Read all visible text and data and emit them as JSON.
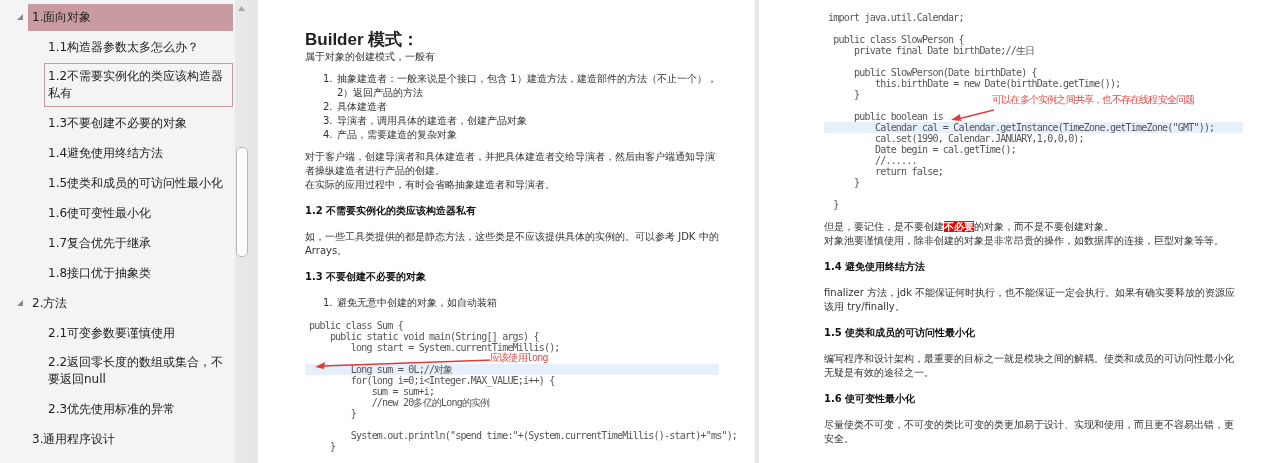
{
  "outline": [
    {
      "label": "1.面向对象",
      "selected": true,
      "focused": false,
      "expanded": true,
      "children": [
        {
          "label": "1.1构造器参数太多怎么办？",
          "selected": false,
          "focused": false
        },
        {
          "label": "1.2不需要实例化的类应该构造器私有",
          "selected": false,
          "focused": true
        },
        {
          "label": "1.3不要创建不必要的对象",
          "selected": false,
          "focused": false
        },
        {
          "label": "1.4避免使用终结方法",
          "selected": false,
          "focused": false
        },
        {
          "label": "1.5使类和成员的可访问性最小化",
          "selected": false,
          "focused": false
        },
        {
          "label": "1.6使可变性最小化",
          "selected": false,
          "focused": false
        },
        {
          "label": "1.7复合优先于继承",
          "selected": false,
          "focused": false
        },
        {
          "label": "1.8接口优于抽象类",
          "selected": false,
          "focused": false
        }
      ]
    },
    {
      "label": "2.方法",
      "selected": false,
      "focused": false,
      "expanded": true,
      "children": [
        {
          "label": "2.1可变参数要谨慎使用",
          "selected": false,
          "focused": false
        },
        {
          "label": "2.2返回零长度的数组或集合，不要返回null",
          "selected": false,
          "focused": false
        },
        {
          "label": "2.3优先使用标准的异常",
          "selected": false,
          "focused": false
        }
      ]
    },
    {
      "label": "3.通用程序设计",
      "selected": false,
      "focused": false,
      "expanded": false
    }
  ],
  "pages": [
    {
      "blocks": [
        {
          "kind": "title",
          "text": "Builder 模式："
        },
        {
          "kind": "paragraph",
          "lines": [
            "属于对象的创建模式，一般有"
          ]
        },
        {
          "kind": "list",
          "items": [
            {
              "number": "1.",
              "text": "抽象建造者：一般来说是个接口，包含 1）建造方法，建造部件的方法（不止一个），2）返回产品的方法"
            },
            {
              "number": "2.",
              "text": "具体建造者"
            },
            {
              "number": "3.",
              "text": "导演者，调用具体的建造者，创建产品对象"
            },
            {
              "number": "4.",
              "text": "产品，需要建造的复杂对象"
            }
          ]
        },
        {
          "kind": "paragraph",
          "lines": [
            "对于客户端，创建导演者和具体建造者，并把具体建造者交给导演者，然后由客户端通知导演者操纵建造者进行产品的创建。",
            "在实际的应用过程中，有时会省略抽象建造者和导演者。"
          ]
        },
        {
          "kind": "heading",
          "text": "1.2 不需要实例化的类应该构造器私有"
        },
        {
          "kind": "paragraph",
          "lines": [
            "如，一些工具类提供的都是静态方法，这些类是不应该提供具体的实例的。可以参考 JDK 中的 Arrays。"
          ]
        },
        {
          "kind": "heading",
          "text": "1.3 不要创建不必要的对象"
        },
        {
          "kind": "list",
          "items": [
            {
              "number": "1.",
              "text": "避免无意中创建的对象，如自动装箱"
            }
          ]
        },
        {
          "kind": "code",
          "annotation": "应该使用long",
          "lines": [
            {
              "text": "public class Sum {",
              "highlighted": false
            },
            {
              "text": "    public static void main(String[] args) {",
              "highlighted": false
            },
            {
              "text": "        long start = System.currentTimeMillis();",
              "highlighted": false
            },
            {
              "highlighted": false
            },
            {
              "text": "        Long sum = 0L;//对象",
              "highlighted": true
            },
            {
              "text": "        for(long i=0;i<Integer.MAX_VALUE;i++) {",
              "highlighted": false
            },
            {
              "text": "            sum = sum+i;",
              "highlighted": false
            },
            {
              "text": "            //new 20多亿的Long的实例",
              "highlighted": false
            },
            {
              "text": "        }",
              "highlighted": false
            },
            {
              "highlighted": false
            },
            {
              "text": "        System.out.println(\"spend time:\"+(System.currentTimeMillis()-start)+\"ms\");",
              "highlighted": false
            },
            {
              "text": "    }",
              "highlighted": false
            }
          ]
        }
      ]
    },
    {
      "blocks": [
        {
          "kind": "code",
          "annotation": "可以在多个实例之间共享，也不存在线程安全问题",
          "lines": [
            {
              "text": "import java.util.Calendar;",
              "highlighted": false
            },
            {
              "highlighted": false
            },
            {
              "text": " public class SlowPerson {",
              "highlighted": false
            },
            {
              "text": "     private final Date birthDate;//生日",
              "highlighted": false
            },
            {
              "highlighted": false
            },
            {
              "text": "     public SlowPerson(Date birthDate) {",
              "highlighted": false
            },
            {
              "text": "         this.birthDate = new Date(birthDate.getTime());",
              "highlighted": false
            },
            {
              "text": "     }",
              "highlighted": false
            },
            {
              "highlighted": false
            },
            {
              "text": "     public boolean is",
              "highlighted": false
            },
            {
              "text": "         Calendar cal = Calendar.getInstance(TimeZone.getTimeZone(\"GMT\"));",
              "highlighted": true
            },
            {
              "text": "         cal.set(1990, Calendar.JANUARY,1,0,0,0);",
              "highlighted": false
            },
            {
              "text": "         Date begin = cal.getTime();",
              "highlighted": false
            },
            {
              "text": "         //......",
              "highlighted": false
            },
            {
              "text": "         return false;",
              "highlighted": false
            },
            {
              "text": "     }",
              "highlighted": false
            },
            {
              "highlighted": false
            },
            {
              "text": " }",
              "highlighted": false
            }
          ]
        },
        {
          "kind": "paragraph",
          "lines": [
            "但是，要记住，是不要创建**不必要**的对象，而不是不要创建对象。",
            "对象池要谨慎使用，除非创建的对象是非常昂贵的操作，如数据库的连接，巨型对象等等。"
          ]
        },
        {
          "kind": "heading",
          "text": "1.4 避免使用终结方法"
        },
        {
          "kind": "paragraph",
          "lines": [
            "finalizer 方法，jdk 不能保证何时执行，也不能保证一定会执行。如果有确实要释放的资源应该用 try/finally。"
          ]
        },
        {
          "kind": "heading",
          "text": "1.5 使类和成员的可访问性最小化"
        },
        {
          "kind": "paragraph",
          "lines": [
            "编写程序和设计架构，最重要的目标之一就是模块之间的解耦。使类和成员的可访问性最小化无疑是有效的途径之一。"
          ]
        },
        {
          "kind": "heading",
          "text": "1.6 使可变性最小化"
        },
        {
          "kind": "paragraph",
          "lines": [
            "尽量使类不可变，不可变的类比可变的类更加易于设计、实现和使用，而且更不容易出错，更安全。"
          ]
        }
      ]
    }
  ]
}
